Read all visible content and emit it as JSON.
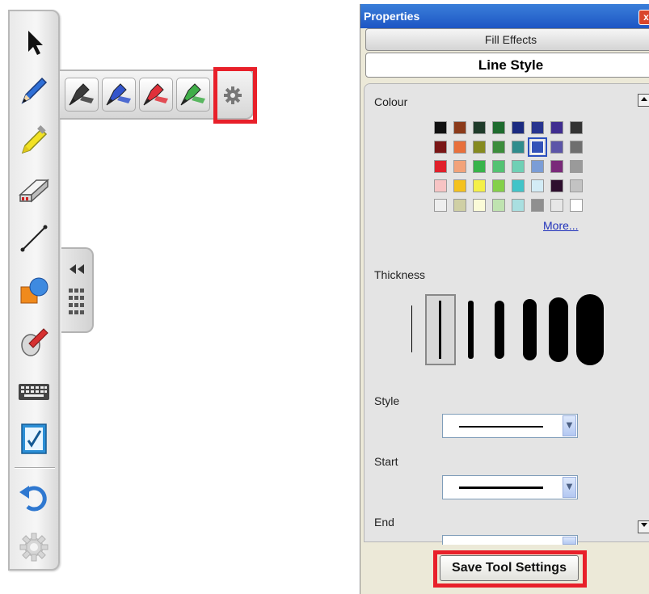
{
  "toolbar": {
    "tools": [
      "select-icon",
      "pen-icon",
      "highlighter-icon",
      "eraser-icon",
      "line-icon",
      "shapes-icon",
      "magic-pen-icon",
      "keyboard-icon",
      "notebook-icon",
      "undo-icon",
      "settings-icon"
    ],
    "pen_colors": [
      "#3a3a3a",
      "#3355cc",
      "#e0303a",
      "#3fae48"
    ]
  },
  "panel": {
    "title": "Properties",
    "close_label": "x",
    "tabs": {
      "fill_effects": "Fill Effects",
      "line_style": "Line Style"
    },
    "colour_label": "Colour",
    "colours": [
      [
        "#111111",
        "#8b3a1a",
        "#1f3b2a",
        "#1e6b2e",
        "#1b2a80",
        "#27348f",
        "#402d90",
        "#333333"
      ],
      [
        "#7a1616",
        "#e8703c",
        "#858a20",
        "#3c8d3c",
        "#2f8c8c",
        "#3352b8",
        "#5c55a8",
        "#6f6f6f"
      ],
      [
        "#e0202a",
        "#f2a279",
        "#37b34a",
        "#53c272",
        "#6fd0b5",
        "#7b9dd6",
        "#7a2a7a",
        "#9a9a9a"
      ],
      [
        "#f7c4c4",
        "#f4c21e",
        "#f4f047",
        "#84d04a",
        "#42c4c8",
        "#d3ecf6",
        "#2e0f2e",
        "#c3c3c3"
      ],
      [
        "#eeeeee",
        "#cfcfa4",
        "#fbfbd8",
        "#bfe3b0",
        "#a9dfe0",
        "#8f8f8f",
        "#e7e7e7",
        "#ffffff"
      ]
    ],
    "selected_colour": {
      "row": 1,
      "col": 5
    },
    "more_label": "More...",
    "thickness_label": "Thickness",
    "style_label": "Style",
    "start_label": "Start",
    "end_label": "End",
    "save_label": "Save Tool Settings"
  }
}
